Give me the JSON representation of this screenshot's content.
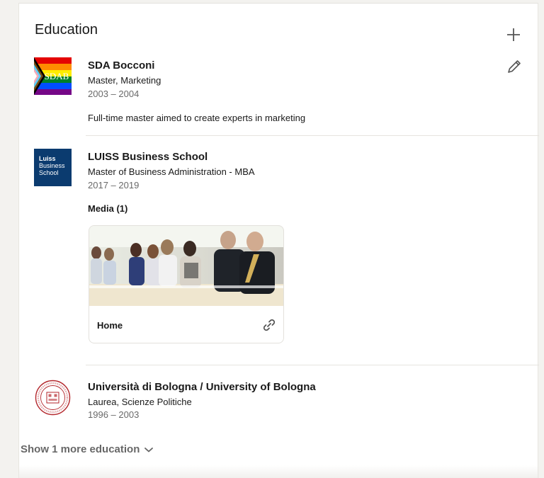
{
  "section": {
    "title": "Education",
    "show_more_label": "Show 1 more education"
  },
  "entries": [
    {
      "school": "SDA Bocconi",
      "degree": "Master, Marketing",
      "years": "2003 – 2004",
      "description": "Full-time master aimed to create experts in marketing",
      "logo_text": "SDAB"
    },
    {
      "school": "LUISS Business School",
      "degree": "Master of Business Administration - MBA",
      "years": "2017 – 2019",
      "logo_lines": [
        "Luiss",
        "Business",
        "School"
      ],
      "media_label": "Media (1)",
      "media": {
        "title": "Home"
      }
    },
    {
      "school": "Università di Bologna / University of Bologna",
      "degree": "Laurea, Scienze Politiche",
      "years": "1996 – 2003"
    }
  ],
  "colors": {
    "luiss_blue": "#0b3b6f",
    "bologna_red": "#b3262b",
    "text_secondary": "#666666"
  },
  "icons": [
    "plus-icon",
    "pencil-icon",
    "link-icon",
    "chevron-down-icon"
  ]
}
